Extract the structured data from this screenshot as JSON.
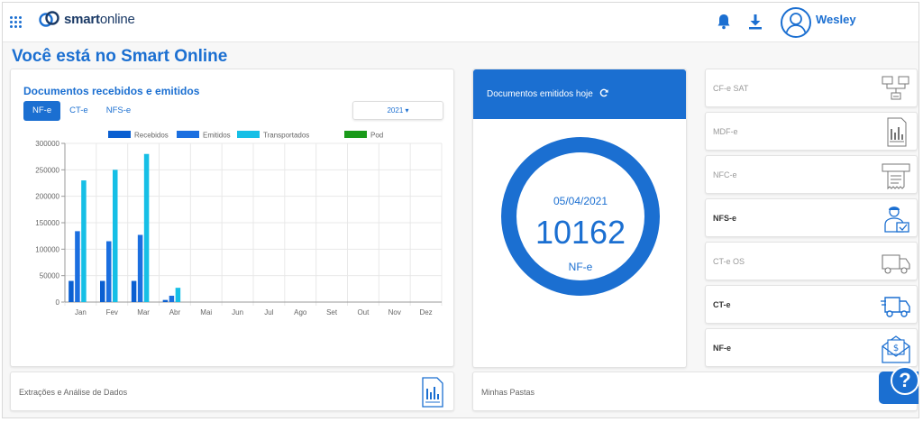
{
  "header": {
    "logo_bold": "smart",
    "logo_light": "online",
    "user_name": "Wesley",
    "icons": [
      "apps-grid-icon",
      "bell-icon",
      "download-icon",
      "user-avatar-icon"
    ]
  },
  "page_title": "Você está no Smart Online",
  "chart_card": {
    "title": "Documentos recebidos e emitidos",
    "tabs": [
      "NF-e",
      "CT-e",
      "NFS-e"
    ],
    "active_tab": "NF-e",
    "year": "2021"
  },
  "chart_data": {
    "type": "bar",
    "title": "",
    "categories": [
      "Jan",
      "Fev",
      "Mar",
      "Abr",
      "Mai",
      "Jun",
      "Jul",
      "Ago",
      "Set",
      "Out",
      "Nov",
      "Dez"
    ],
    "series": [
      {
        "name": "Recebidos",
        "color": "#0a5fd1",
        "values": [
          40000,
          40000,
          40000,
          4000,
          0,
          0,
          0,
          0,
          0,
          0,
          0,
          0
        ]
      },
      {
        "name": "Emitidos",
        "color": "#1b6fe0",
        "values": [
          134000,
          115000,
          127000,
          12000,
          0,
          0,
          0,
          0,
          0,
          0,
          0,
          0
        ]
      },
      {
        "name": "Transportados",
        "color": "#16bfe6",
        "values": [
          230000,
          250000,
          280000,
          27000,
          0,
          0,
          0,
          0,
          0,
          0,
          0,
          0
        ]
      },
      {
        "name": "Pod",
        "color": "#1a9a1a",
        "values": [
          0,
          0,
          0,
          0,
          0,
          0,
          0,
          0,
          0,
          0,
          0,
          0
        ]
      }
    ],
    "yticks": [
      "0",
      "50000",
      "100000",
      "150000",
      "200000",
      "250000",
      "300000"
    ],
    "ylim": [
      0,
      300000
    ],
    "grid": true,
    "legend": "top"
  },
  "today": {
    "title": "Documentos emitidos hoje",
    "date": "05/04/2021",
    "count": "10162",
    "doc_type": "NF-e"
  },
  "side_items": [
    {
      "label": "CF-e SAT",
      "icon": "sat-terminal-icon",
      "active": false
    },
    {
      "label": "MDF-e",
      "icon": "document-chart-icon",
      "active": false
    },
    {
      "label": "NFC-e",
      "icon": "receipt-printer-icon",
      "active": false
    },
    {
      "label": "NFS-e",
      "icon": "service-worker-icon",
      "active": true
    },
    {
      "label": "CT-e OS",
      "icon": "truck-icon",
      "active": false
    },
    {
      "label": "CT-e",
      "icon": "truck-icon",
      "active": true
    },
    {
      "label": "NF-e",
      "icon": "invoice-envelope-icon",
      "active": true
    }
  ],
  "bottom": {
    "extractions": "Extrações e Análise de Dados",
    "folders": "Minhas Pastas",
    "help": "?"
  }
}
